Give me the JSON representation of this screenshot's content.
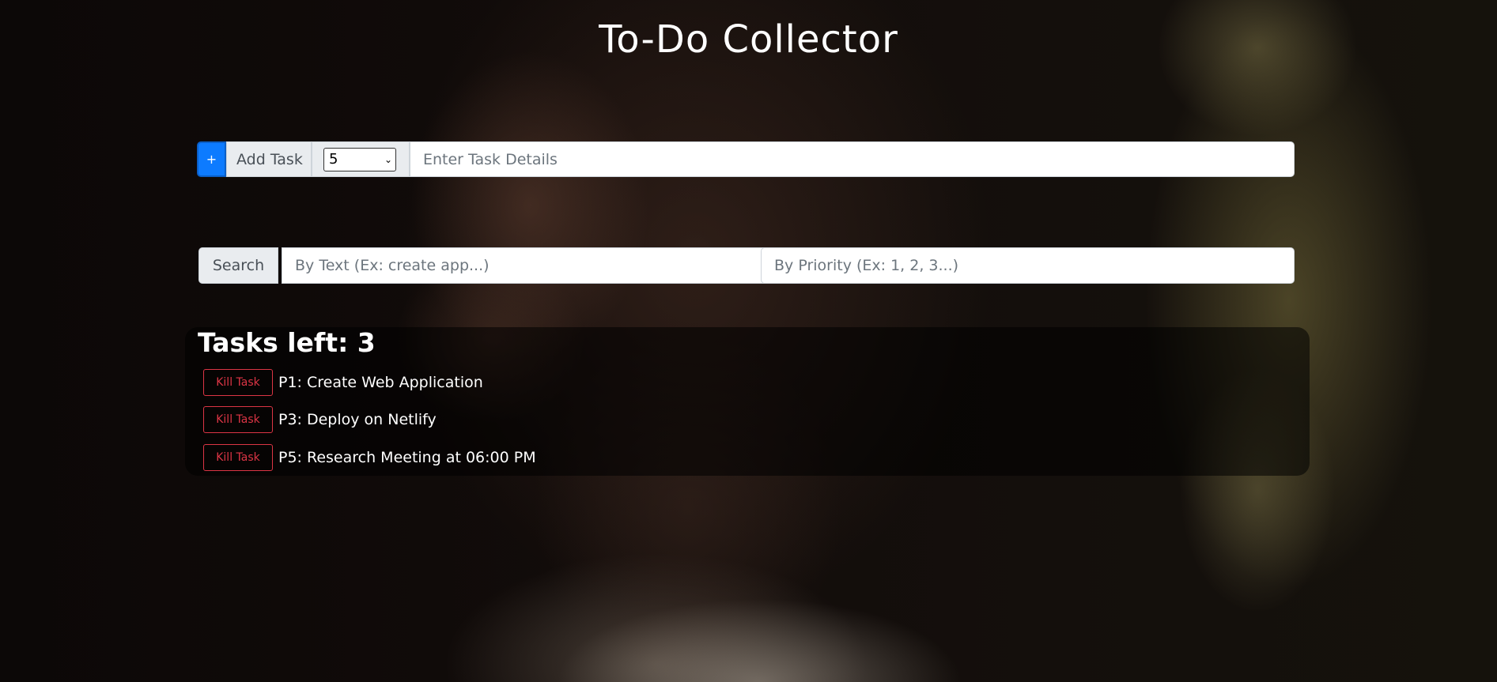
{
  "app": {
    "title": "To-Do Collector"
  },
  "add_task": {
    "plus_label": "+",
    "button_label": "Add Task",
    "priority_selected": "5",
    "details_placeholder": "Enter Task Details"
  },
  "search": {
    "label": "Search",
    "text_placeholder": "By Text (Ex: create app...)",
    "priority_placeholder": "By Priority (Ex: 1, 2, 3...)"
  },
  "tasks": {
    "heading": "Tasks left: 3",
    "kill_label": "Kill Task",
    "items": [
      {
        "kill_label": "Kill Task",
        "text": "P1: Create Web Application"
      },
      {
        "kill_label": "Kill Task",
        "text": "P3: Deploy on Netlify"
      },
      {
        "kill_label": "Kill Task",
        "text": "P5: Research Meeting at 06:00 PM"
      }
    ]
  },
  "colors": {
    "primary": "#0d7bff",
    "danger": "#dc3545",
    "addon_bg": "#e9ecef"
  }
}
